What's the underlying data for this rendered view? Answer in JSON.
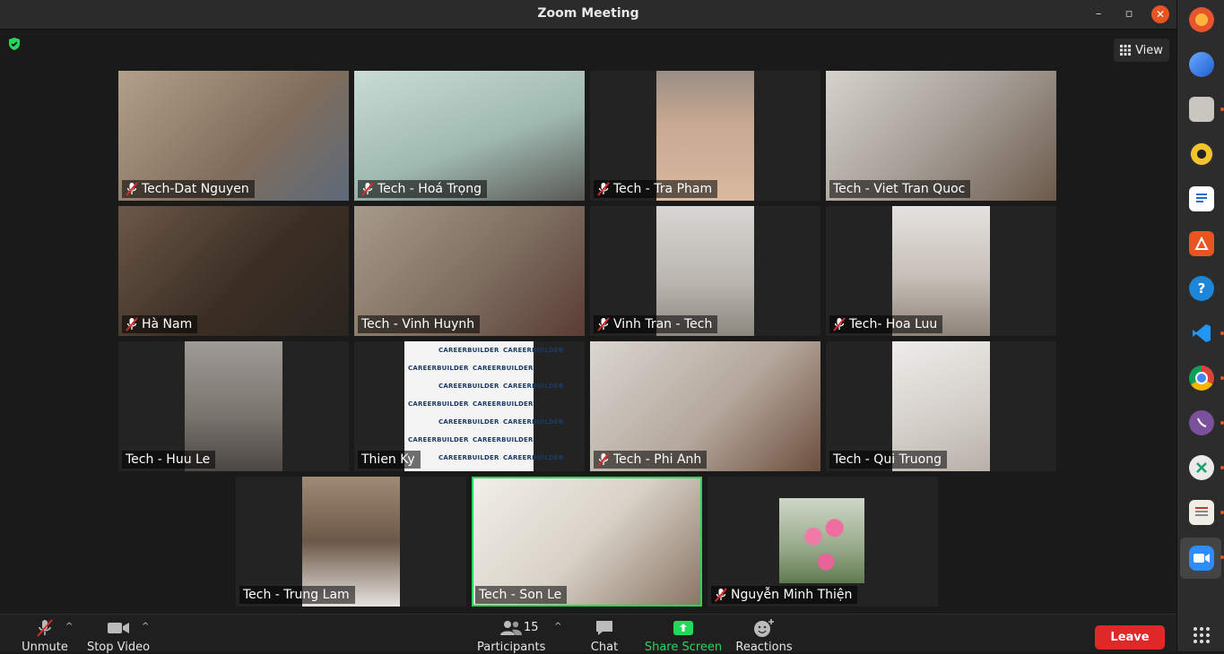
{
  "window": {
    "title": "Zoom Meeting",
    "minimize": "–",
    "maximize": "▫",
    "close": "✕"
  },
  "top": {
    "view_label": "View"
  },
  "participants": [
    {
      "name": "Tech-Dat Nguyen",
      "muted": true,
      "bg": "#9a8670"
    },
    {
      "name": "Tech - Hoá Trọng",
      "muted": true,
      "bg": "#a9c3bc"
    },
    {
      "name": "Tech - Tra Pham",
      "muted": true,
      "bg": "#b79a86"
    },
    {
      "name": "Tech - Viet Tran Quoc",
      "muted": false,
      "bg": "#9a968f"
    },
    {
      "name": "Hà Nam",
      "muted": true,
      "bg": "#4b3a2d"
    },
    {
      "name": "Tech - Vinh Huynh",
      "muted": false,
      "bg": "#8a7a6a"
    },
    {
      "name": "Vinh Tran - Tech",
      "muted": true,
      "bg": "#c8c4c0"
    },
    {
      "name": "Tech- Hoa Luu",
      "muted": true,
      "bg": "#b8b0a8"
    },
    {
      "name": "Tech - Huu Le",
      "muted": false,
      "bg": "#8c8a86"
    },
    {
      "name": "Thien Ky",
      "muted": false,
      "bg": "#f2f2f2"
    },
    {
      "name": "Tech - Phi Anh",
      "muted": true,
      "bg": "#b5aba2"
    },
    {
      "name": "Tech - Qui Truong",
      "muted": false,
      "bg": "#d6d3ce"
    },
    {
      "name": "Tech - Trung Lam",
      "muted": false,
      "bg": "#7f6a58"
    },
    {
      "name": "Tech - Son Le",
      "muted": false,
      "bg": "#d8d2c8"
    },
    {
      "name": "Nguyễn Minh Thiện",
      "muted": true,
      "bg": "#b9c7b0"
    }
  ],
  "thien_ky_brand": "CAREERBUILDER",
  "toolbar": {
    "unmute": "Unmute",
    "stop_video": "Stop Video",
    "participants": "Participants",
    "participant_count": "15",
    "chat": "Chat",
    "share_screen": "Share Screen",
    "reactions": "Reactions",
    "leave": "Leave"
  },
  "colors": {
    "accent_green": "#23d959",
    "leave_red": "#e02828",
    "ubuntu_orange": "#e95420"
  }
}
